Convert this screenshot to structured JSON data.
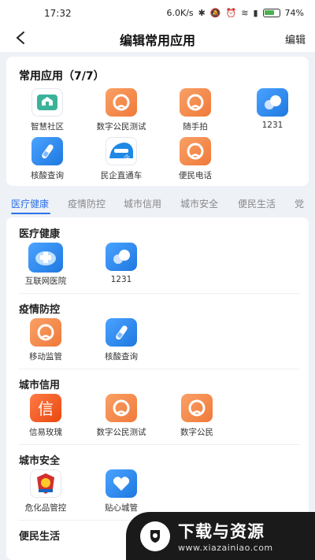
{
  "status": {
    "time": "17:32",
    "speed": "6.0K/s",
    "battery": "74",
    "battery_unit": "%"
  },
  "nav": {
    "title": "编辑常用应用",
    "edit": "编辑"
  },
  "favorites": {
    "title": "常用应用（7/7）",
    "apps": [
      {
        "label": "智慧社区"
      },
      {
        "label": "数字公民测试"
      },
      {
        "label": "随手拍"
      },
      {
        "label": "1231"
      },
      {
        "label": "核酸查询"
      },
      {
        "label": "民企直通车"
      },
      {
        "label": "便民电话"
      }
    ]
  },
  "tabs": [
    "医疗健康",
    "疫情防控",
    "城市信用",
    "城市安全",
    "便民生活",
    "党"
  ],
  "sections": [
    {
      "title": "医疗健康",
      "apps": [
        {
          "label": "互联网医院"
        },
        {
          "label": "1231"
        }
      ]
    },
    {
      "title": "疫情防控",
      "apps": [
        {
          "label": "移动监管"
        },
        {
          "label": "核酸查询"
        }
      ]
    },
    {
      "title": "城市信用",
      "apps": [
        {
          "label": "信易玫瑰"
        },
        {
          "label": "数字公民测试"
        },
        {
          "label": "数字公民"
        }
      ]
    },
    {
      "title": "城市安全",
      "apps": [
        {
          "label": "危化品管控"
        },
        {
          "label": "贴心城管"
        }
      ]
    },
    {
      "title": "便民生活"
    }
  ],
  "watermark": {
    "title": "下载与资源",
    "url": "www.xiazainiao.com"
  },
  "colors": {
    "accent": "#2f72e8",
    "orange": "#f07a3a",
    "blue": "#1f78e0"
  }
}
